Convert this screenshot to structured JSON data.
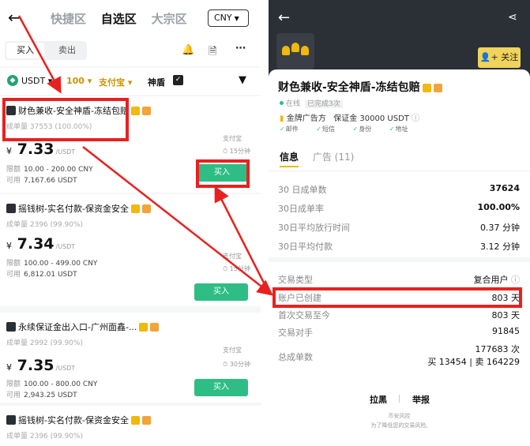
{
  "left": {
    "back_icon": "back-arrow-icon",
    "tabs": [
      "快捷区",
      "自选区",
      "大宗区"
    ],
    "currency": "CNY",
    "side_buy": "买入",
    "side_sell": "卖出",
    "filter": {
      "asset": "USDT",
      "amount": "100",
      "payment": "支付宝",
      "shield": "神盾"
    },
    "cards": [
      {
        "name": "财色兼收-安全神盾-冻结包赔",
        "stats": "成单量 37553 (100.00%)",
        "pay": "支付宝",
        "time": "15分钟",
        "price": "7.33",
        "currency_symbol": "¥",
        "unit": "/USDT",
        "limit_label": "限额",
        "limit": "10.00 - 200.00 CNY",
        "avail_label": "可用",
        "avail": "7,167.66 USDT",
        "button": "买入"
      },
      {
        "name": "摇钱树-实名付款-保资金安全",
        "stats": "成单量 2396 (99.90%)",
        "pay": "支付宝",
        "time": "15分钟",
        "price": "7.34",
        "currency_symbol": "¥",
        "unit": "/USDT",
        "limit_label": "限额",
        "limit": "100.00 - 499.00 CNY",
        "avail_label": "可用",
        "avail": "6,812.01 USDT",
        "button": "买入"
      },
      {
        "name": "永续保证金出入口-广州面鑫-...",
        "stats": "成单量 2992 (99.90%)",
        "pay": "支付宝",
        "time": "30分钟",
        "price": "7.35",
        "currency_symbol": "¥",
        "unit": "/USDT",
        "limit_label": "限额",
        "limit": "100.00 - 800.00 CNY",
        "avail_label": "可用",
        "avail": "2,943.25 USDT",
        "button": "买入"
      },
      {
        "name": "摇钱树-实名付款-保资金安全",
        "stats": "成单量 2396 (99.90%)"
      }
    ]
  },
  "right": {
    "follow": "关注",
    "title": "财色兼收-安全神盾-冻结包赔",
    "status": "在线",
    "status_tag": "已完成3次",
    "merchant_type": "金牌广告方",
    "deposit": "保证金 30000 USDT",
    "verifications": [
      "邮件",
      "短信",
      "身份",
      "地址"
    ],
    "tab_info": "信息",
    "tab_ads": "广告 (11)",
    "stats": [
      {
        "label": "30 日成单数",
        "value": "37624"
      },
      {
        "label": "30日成单率",
        "value": "100.00%"
      },
      {
        "label": "30日平均放行时间",
        "value": "0.37 分钟"
      },
      {
        "label": "30日平均付款",
        "value": "3.12 分钟"
      }
    ],
    "details": [
      {
        "label": "交易类型",
        "value": "复合用户"
      },
      {
        "label": "账户已创建",
        "value": "803 天"
      },
      {
        "label": "首次交易至今",
        "value": "803 天"
      },
      {
        "label": "交易对手",
        "value": "91845"
      },
      {
        "label": "总成单数",
        "value": "177683 次",
        "value2": "买 13454 | 卖 164229"
      }
    ],
    "link_block": "拉黑",
    "link_report": "举报",
    "footer1": "币安风控",
    "footer2": "为了降低您的交易风险,"
  },
  "colors": {
    "accent": "#f0b90b",
    "buy": "#2ebd85",
    "highlight": "#e8211f"
  }
}
